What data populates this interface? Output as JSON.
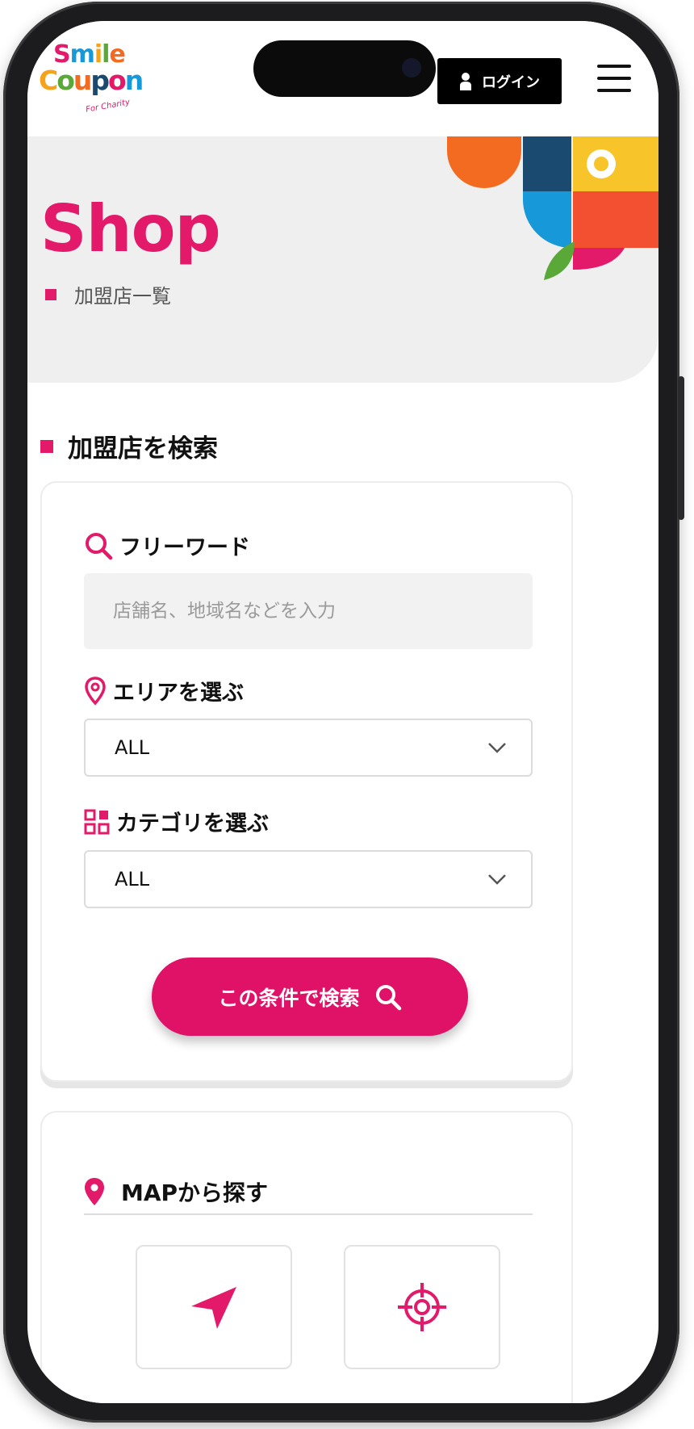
{
  "header": {
    "logo": {
      "line1": "Smile",
      "line2": "Coupon",
      "tagline": "For Charity"
    },
    "login_label": "ログイン",
    "login_icon": "user-icon",
    "menu_icon": "hamburger-icon"
  },
  "hero": {
    "title": "Shop",
    "subtitle": "加盟店一覧"
  },
  "search_section": {
    "title": "加盟店を検索",
    "freeword": {
      "label": "フリーワード",
      "icon": "search-icon",
      "placeholder": "店舗名、地域名などを入力",
      "value": ""
    },
    "area": {
      "label": "エリアを選ぶ",
      "icon": "map-pin-icon",
      "selected": "ALL"
    },
    "category": {
      "label": "カテゴリを選ぶ",
      "icon": "grid-icon",
      "selected": "ALL"
    },
    "submit_label": "この条件で検索"
  },
  "map_section": {
    "title": "MAPから探す",
    "icon": "map-pin-icon",
    "tiles": [
      {
        "icon": "navigation-arrow-icon"
      },
      {
        "icon": "crosshair-icon"
      }
    ]
  },
  "colors": {
    "accent": "#e3196a",
    "button": "#df1267",
    "hero_bg": "#efefef",
    "frame": "#1c1c1e"
  }
}
